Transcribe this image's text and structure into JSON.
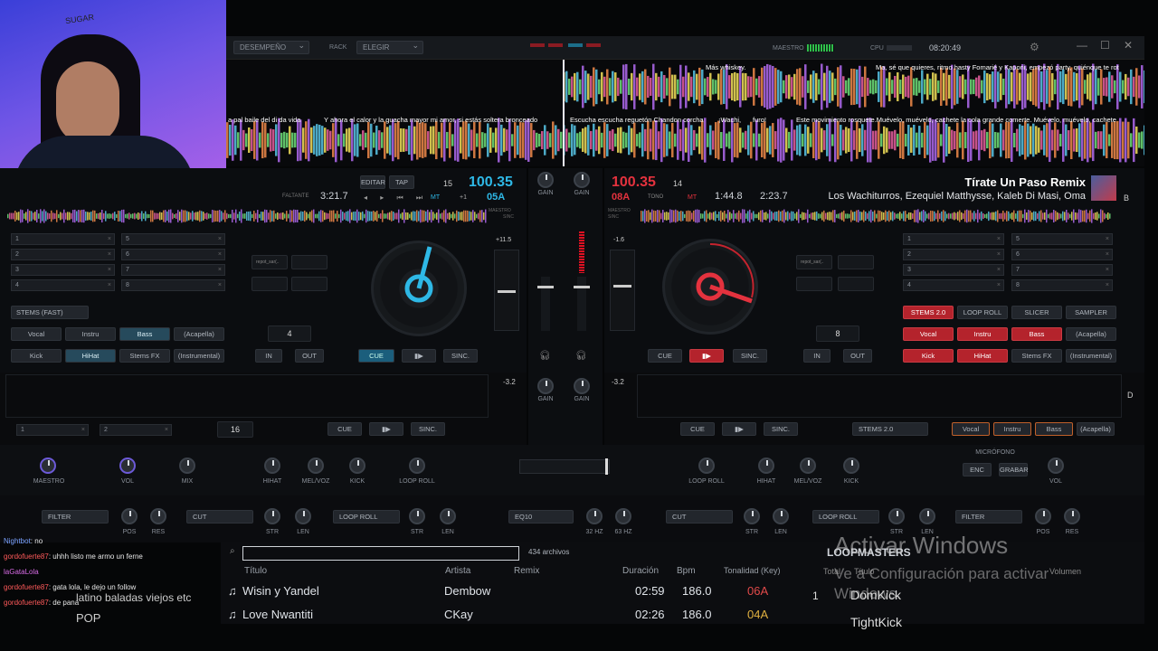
{
  "topbar": {
    "layout": "DESEMPEÑO",
    "rack_label": "RACK",
    "rack": "ELEGIR",
    "master_label": "MAESTRO",
    "cpu_label": "CPU",
    "clock": "08:20:49"
  },
  "lyrics_top": [
    "Más whiskey.",
    "Ma, sé que quieres, ritmo hasty Fomarié y Kaponi, empezó party, quiénque te rot"
  ],
  "lyrics_bottom": [
    "a pal baile del di da vida",
    "Y ahora el calor y la guacha mayor mi amor, si estás soltera bronceado",
    "Escucha escucha reguetón Chandon corcha",
    "¡Wachi,",
    "furo!",
    "Este movimiento rosquete.Muévelo, muévelo, cachete la cola grande comerte. Muévelo, muévelo, cachete"
  ],
  "deckA": {
    "remaining_label": "FALTANTE",
    "remaining": "3:21.7",
    "edit": "EDITAR",
    "tap": "TAP",
    "bpm": "100.35",
    "key": "05A",
    "pitch_step": "15",
    "mt": "MT",
    "offset": "+1",
    "tempo_range": "+11.5",
    "master_lbl": "MAESTRO",
    "sync_lbl": "SINC",
    "hotcues": [
      "1",
      "2",
      "3",
      "4",
      "5",
      "6",
      "7",
      "8"
    ],
    "stems_select": "STEMS (FAST)",
    "stems_row1": [
      "Vocal",
      "Instru",
      "Bass",
      "(Acapella)"
    ],
    "stems_row2": [
      "Kick",
      "HiHat",
      "Stems FX",
      "(Instrumental)"
    ],
    "loop_val": "4",
    "in": "IN",
    "out": "OUT",
    "cue": "CUE",
    "play": "▮▶",
    "sync": "SINC.",
    "gain": "GAIN",
    "pad1": "repot_sar(.."
  },
  "deckB": {
    "bpm": "100.35",
    "key": "08A",
    "tono": "TONO",
    "pitch_step": "14",
    "mt": "MT",
    "elapsed": "1:44.8",
    "remaining": "2:23.7",
    "title": "Tírate Un Paso Remix",
    "artist": "Los Wachiturros, Ezequiel Matthysse, Kaleb Di Masi, Oma",
    "side": "B",
    "tempo_range": "-1.6",
    "master_lbl": "MAESTRO",
    "sync_lbl": "SINC",
    "hotcues": [
      "1",
      "2",
      "3",
      "4",
      "5",
      "6",
      "7",
      "8"
    ],
    "tabs": [
      "STEMS 2.0",
      "LOOP ROLL",
      "SLICER",
      "SAMPLER"
    ],
    "stems_row1": [
      "Vocal",
      "Instru",
      "Bass",
      "(Acapella)"
    ],
    "stems_row2": [
      "Kick",
      "HiHat",
      "Stems FX",
      "(Instrumental)"
    ],
    "loop_val": "8",
    "in": "IN",
    "out": "OUT",
    "cue": "CUE",
    "play": "▮▶",
    "sync": "SINC.",
    "pad1": "repot_sar(.."
  },
  "deckC": {
    "pitch": "-3.2",
    "loop_val": "16",
    "cue": "CUE",
    "play": "▮▶",
    "sync": "SINC.",
    "hot": [
      "1",
      "2"
    ]
  },
  "deckD": {
    "pitch": "-3.2",
    "side": "D",
    "cue": "CUE",
    "play": "▮▶",
    "sync": "SINC.",
    "stems_select": "STEMS 2.0",
    "stems": [
      "Vocal",
      "Instru",
      "Bass",
      "(Acapella)"
    ]
  },
  "mixer": {
    "gain": "GAIN",
    "knobsL": [
      "MAESTRO",
      "VOL",
      "MIX"
    ],
    "eqL": [
      "HIHAT",
      "MEL/VOZ",
      "KICK",
      "LOOP ROLL"
    ],
    "eqR": [
      "LOOP ROLL",
      "HIHAT",
      "MEL/VOZ",
      "KICK"
    ],
    "mic": "MICRÓFONO",
    "enc": "ENC",
    "grabar": "GRABAR",
    "vol": "VOL"
  },
  "fx": {
    "left": [
      {
        "name": "FILTER",
        "k": [
          "POS",
          "RES"
        ]
      },
      {
        "name": "CUT",
        "k": [
          "STR",
          "LEN"
        ]
      },
      {
        "name": "LOOP ROLL",
        "k": [
          "STR",
          "LEN"
        ]
      }
    ],
    "center": {
      "name": "EQ10",
      "k": [
        "32 Hz",
        "63 Hz"
      ]
    },
    "right": [
      {
        "name": "CUT",
        "k": [
          "STR",
          "LEN"
        ]
      },
      {
        "name": "LOOP ROLL",
        "k": [
          "STR",
          "LEN"
        ]
      },
      {
        "name": "FILTER",
        "k": [
          "POS",
          "RES"
        ]
      }
    ]
  },
  "browser": {
    "search": "",
    "count": "434 archivos",
    "cols": [
      "Título",
      "Artista",
      "Remix",
      "Duración",
      "Bpm",
      "Tonalidad (Key)"
    ],
    "rows": [
      {
        "title": "Wisin y Yandel",
        "artist": "Dembow",
        "dur": "02:59",
        "bpm": "186.0",
        "key": "06A"
      },
      {
        "title": "Love Nwantiti",
        "artist": "CKay",
        "dur": "02:26",
        "bpm": "186.0",
        "key": "04A"
      }
    ]
  },
  "side": {
    "title": "LOOPMASTERS",
    "col1": "Total",
    "col2": "Título",
    "col3": "Volumen",
    "row_num": "1",
    "row_name": "DomKick",
    "row2": "TightKick"
  },
  "chat": [
    {
      "user": "Nightbot",
      "msg": ": no"
    },
    {
      "user": "gordofuerte87",
      "msg": ": uhhh listo me armo un ferne"
    },
    {
      "user": "laGataLola",
      "msg": ""
    },
    {
      "user": "gordofuerte87",
      "msg": ": gata lola, le dejo un follow"
    },
    {
      "user": "gordofuerte87",
      "msg": ": de pana"
    }
  ],
  "chat_overlay": [
    "latino baladas viejos etc",
    "POP"
  ],
  "watermark": {
    "title": "Activar Windows",
    "sub": "Ve a Configuración para activar Windows."
  },
  "webcam": {
    "sign": "SUGAR"
  }
}
